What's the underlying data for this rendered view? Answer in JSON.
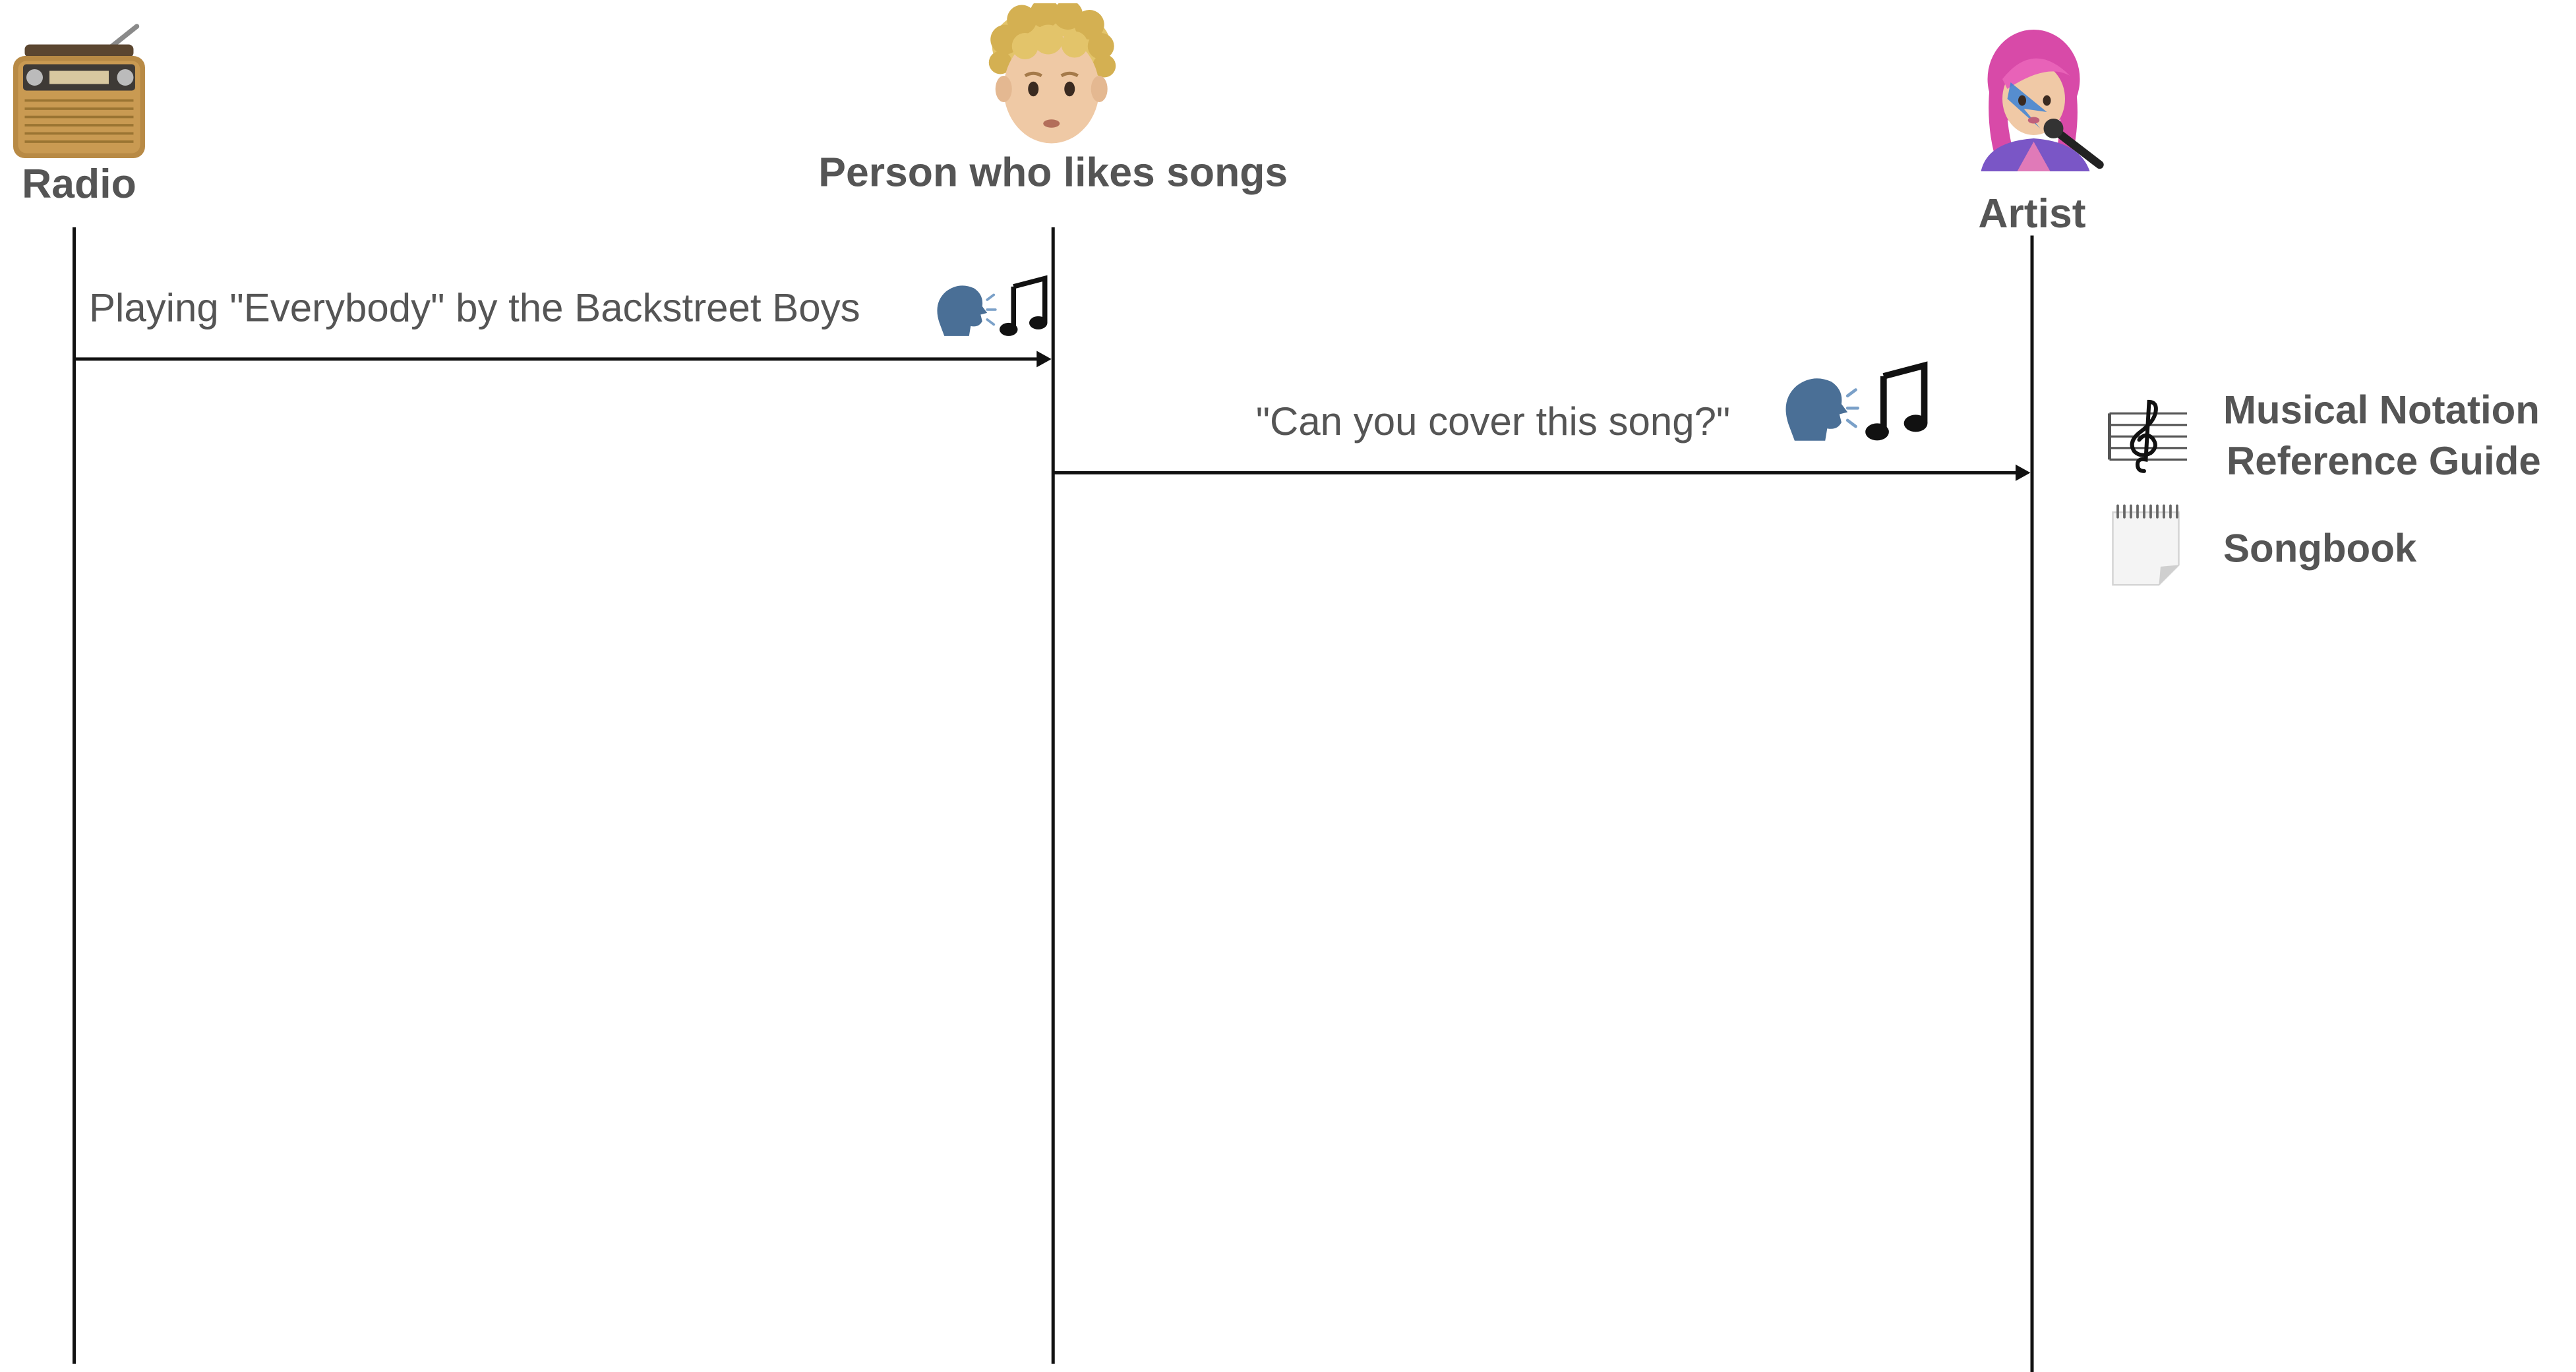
{
  "actors": {
    "radio": {
      "label": "Radio",
      "icon": "radio-icon"
    },
    "person": {
      "label": "Person who likes songs",
      "icon": "person-icon"
    },
    "artist": {
      "label": "Artist",
      "icon": "singer-icon"
    }
  },
  "messages": [
    {
      "from": "Radio",
      "to": "Person who likes songs",
      "text": "Playing \"Everybody\" by the Backstreet Boys",
      "icons": [
        "speaking-head-icon",
        "music-note-icon"
      ]
    },
    {
      "from": "Person who likes songs",
      "to": "Artist",
      "text": "\"Can you cover this song?\"",
      "icons": [
        "speaking-head-icon",
        "music-notes-icon"
      ]
    }
  ],
  "resources": [
    {
      "icon": "musical-score-icon",
      "label_line1": "Musical Notation",
      "label_line2": "Reference Guide"
    },
    {
      "icon": "spiral-notepad-icon",
      "label": "Songbook"
    }
  ],
  "colors": {
    "text": "#555555",
    "lines": "#111111",
    "speaking_head": "#4a6f96"
  }
}
